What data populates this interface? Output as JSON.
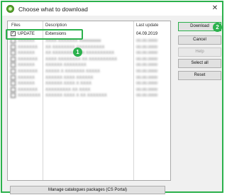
{
  "window": {
    "title": "Choose what to download",
    "close_glyph": "✕"
  },
  "list": {
    "headers": {
      "files": "Files",
      "description": "Description",
      "last_update": "Last update"
    },
    "first_row": {
      "checked": true,
      "check_glyph": "✓",
      "file": "UPDATE",
      "description": "Extensions",
      "last_update": "04.09.2019"
    },
    "blurred_rows": [
      {
        "file": "XXXXXX",
        "description": "XXXX XXXXXXX Xxxxxxxxxx",
        "last_update": "00.00.0000"
      },
      {
        "file": "XXXXXXX",
        "description": "XX XXXXXXXX XXXXXXXXXX",
        "last_update": "00.00.0000"
      },
      {
        "file": "XXXXXX",
        "description": "XX XXXXXXXX XXX XXXXXXXXXX",
        "last_update": "00.00.0000"
      },
      {
        "file": "XXXXXXX",
        "description": "XXXX XXXXXXXX XX XXXXXXXXXX",
        "last_update": "00.00.0000"
      },
      {
        "file": "XXXXXX",
        "description": "XXXXXX XXXXXXXX",
        "last_update": "00.00.0000"
      },
      {
        "file": "XXXXXXX",
        "description": "XXXXX X XXXXXXX XXXXX",
        "last_update": "00.00.0000"
      },
      {
        "file": "XXXXXX",
        "description": "XXXXXX XXXX XXXXXX",
        "last_update": "00.00.0000"
      },
      {
        "file": "XXXXXX",
        "description": "XXXXXX XXXX X XXXX",
        "last_update": "00.00.0000"
      },
      {
        "file": "XXXXXXX",
        "description": "XXXXXXXXX XX XXXX",
        "last_update": "00.00.0000"
      },
      {
        "file": "XXXXXXXX",
        "description": "XXXXXX XXXX X XX XXXXXXX",
        "last_update": "00.00.0000"
      }
    ]
  },
  "buttons": {
    "download": "Download",
    "cancel": "Cancel",
    "help": "Help",
    "select_all": "Select all",
    "reset": "Reset",
    "manage": "Manage catalogues packages (CS Portal)"
  },
  "annotations": {
    "badge_1": "1",
    "badge_2": "2",
    "color": "#2bb14c"
  }
}
